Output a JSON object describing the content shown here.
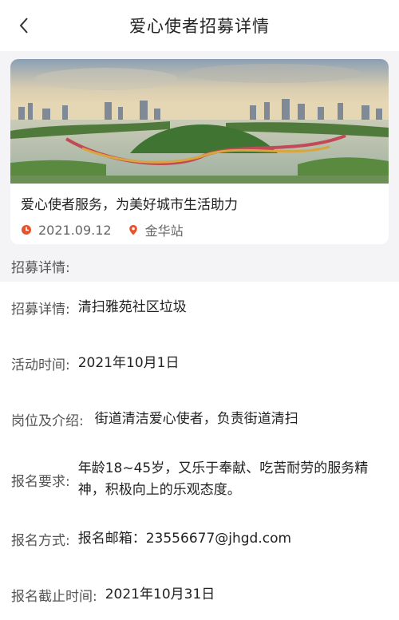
{
  "header": {
    "title": "爱心使者招募详情",
    "back_icon": "chevron-left-icon"
  },
  "card": {
    "title": "爱心使者服务，为美好城市生活助力",
    "date": "2021.09.12",
    "location": "金华站",
    "clock_icon_color": "#e8512b",
    "pin_icon_color": "#e8512b"
  },
  "section_heading": "招募详情:",
  "details": [
    {
      "label": "招募详情:",
      "value": "清扫雅苑社区垃圾"
    },
    {
      "label": "活动时间:",
      "value": "2021年10月1日"
    },
    {
      "label": "岗位及介绍:",
      "value": "街道清洁爱心使者，负责街道清扫"
    },
    {
      "label": "报名要求:",
      "value": "年龄18~45岁，又乐于奉献、吃苦耐劳的服务精神，积极向上的乐观态度。"
    },
    {
      "label": "报名方式:",
      "value": "报名邮箱：23556677@jhgd.com"
    },
    {
      "label": "报名截止时间:",
      "value": "2021年10月31日"
    }
  ]
}
